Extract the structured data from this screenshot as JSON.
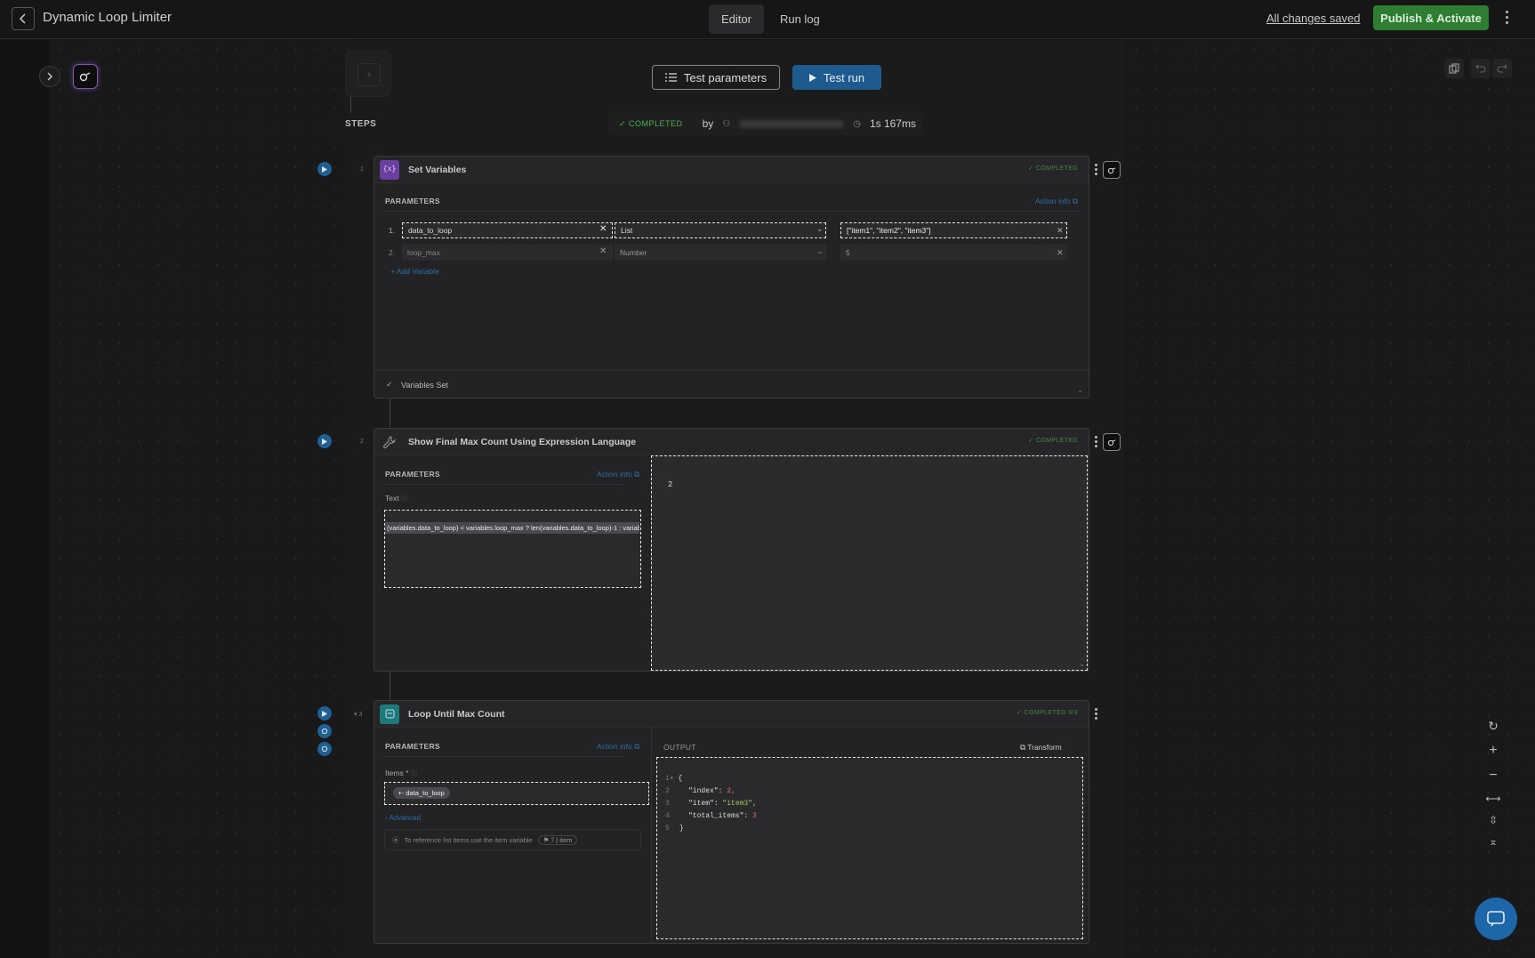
{
  "header": {
    "title": "Dynamic Loop Limiter",
    "tabs": [
      {
        "label": "Editor"
      },
      {
        "label": "Run log"
      }
    ],
    "saved_status": "All changes saved",
    "publish_label": "Publish & Activate"
  },
  "toolbar": {
    "test_parameters_label": "Test parameters",
    "test_run_label": "Test run"
  },
  "run_status": {
    "status": "COMPLETED",
    "by_label": "by",
    "duration": "1s 167ms"
  },
  "steps_label": "STEPS",
  "steps": [
    {
      "number": "1",
      "title": "Set Variables",
      "status": "COMPLETED",
      "parameters_label": "PARAMETERS",
      "action_info_label": "Action info",
      "variables": [
        {
          "index": "1.",
          "name": "data_to_loop",
          "type": "List",
          "value": "[\"item1\", \"item2\", \"item3\"]"
        },
        {
          "index": "2.",
          "name": "loop_max",
          "type": "Number",
          "value": "5"
        }
      ],
      "add_variable_label": "+ Add Variable",
      "footer_label": "Variables Set"
    },
    {
      "number": "2",
      "title": "Show Final Max Count Using Expression Language",
      "status": "COMPLETED",
      "parameters_label": "PARAMETERS",
      "action_info_label": "Action info",
      "text_label": "Text",
      "expression": "(variables.data_to_loop) < variables.loop_max ? len(variables.data_to_loop)-1 : variab",
      "output_value": "2"
    },
    {
      "number": "3",
      "title": "Loop Until Max Count",
      "status": "COMPLETED 3/3",
      "parameters_label": "PARAMETERS",
      "action_info_label": "Action info",
      "items_label": "Items",
      "items_required": "*",
      "items_chip": "data_to_loop",
      "advanced_label": "› Advanced",
      "hint_text": "To reference list items use the item variable",
      "hint_chip": "item",
      "output_label": "OUTPUT",
      "transform_label": "Transform",
      "output_lines": [
        {
          "n": "1",
          "text": "{"
        },
        {
          "n": "2",
          "key": "\"index\"",
          "value": "2,",
          "value_color": "#e06c6c"
        },
        {
          "n": "3",
          "key": "\"item\"",
          "value": "\"item3\",",
          "value_color": "#9ccc65"
        },
        {
          "n": "4",
          "key": "\"total_items\"",
          "value": "3",
          "value_color": "#e06c6c"
        },
        {
          "n": "5",
          "text": "}"
        }
      ]
    }
  ],
  "colors": {
    "accent_blue": "#1d5a8e",
    "publish_green": "#2e7d32",
    "completed_green": "#3f8a48",
    "step1_icon": "#6a3fa0",
    "step3_icon": "#1d7a7a"
  }
}
